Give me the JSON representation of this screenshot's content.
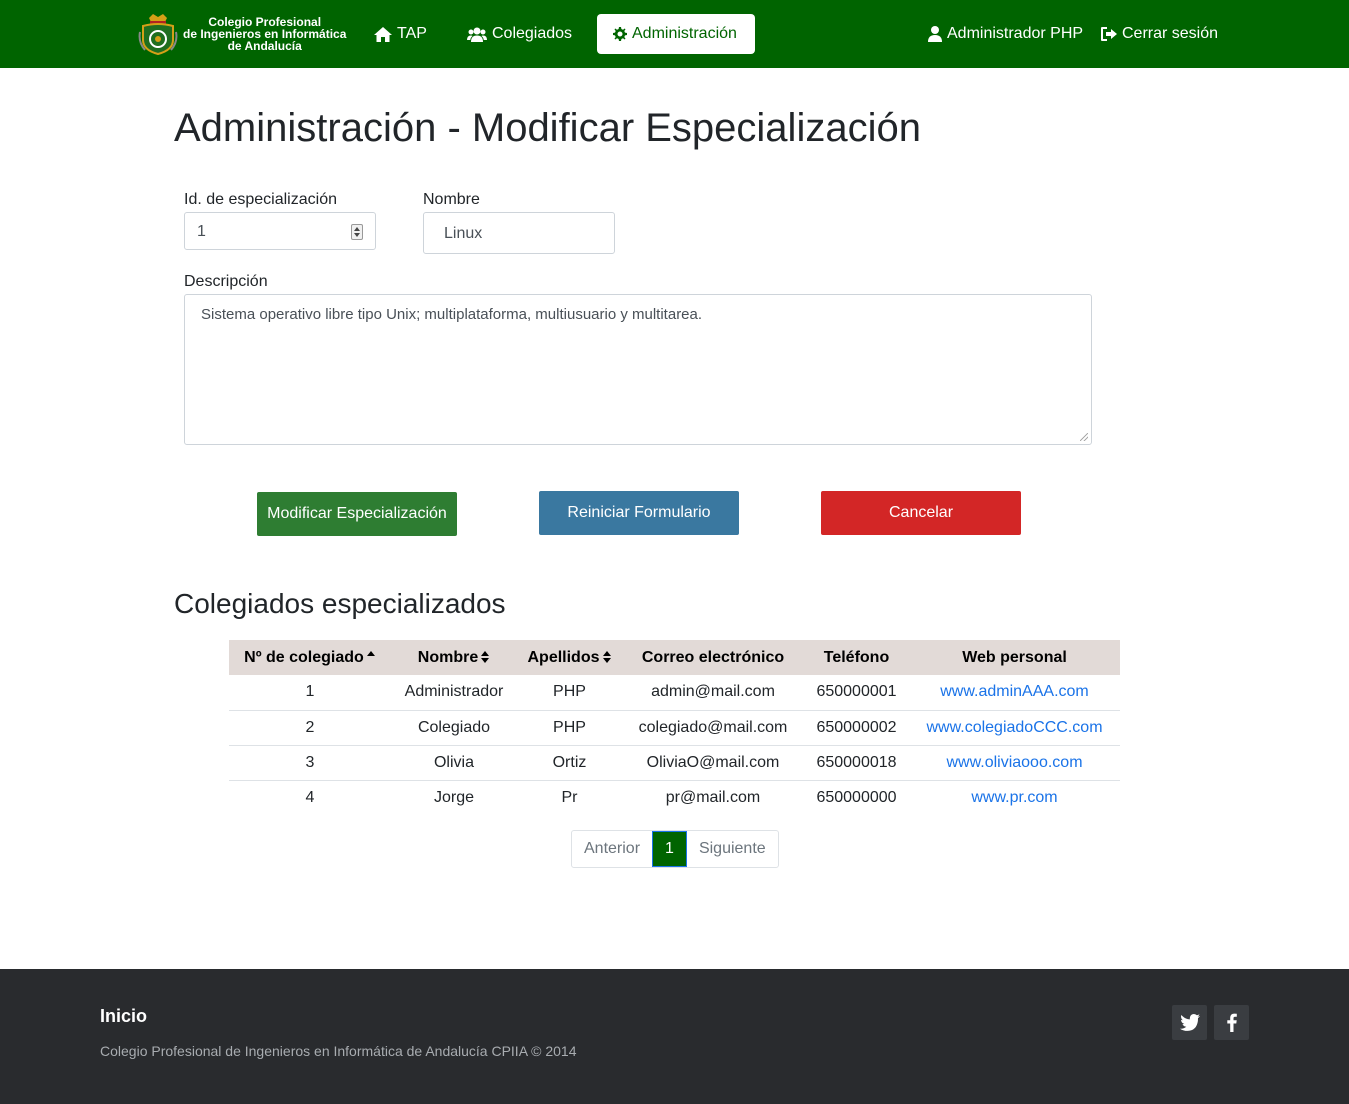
{
  "nav": {
    "brand_line1": "Colegio Profesional",
    "brand_line2": "de Ingenieros en Informática",
    "brand_line3": "de Andalucía",
    "items": [
      {
        "label": "TAP",
        "icon": "home-icon"
      },
      {
        "label": "Colegiados",
        "icon": "users-icon"
      },
      {
        "label": "Administración",
        "icon": "gear-icon",
        "active": true
      }
    ],
    "user_label": "Administrador PHP",
    "logout_label": "Cerrar sesión",
    "color": "#006400"
  },
  "page": {
    "title": "Administración - Modificar Especialización"
  },
  "form": {
    "id_label": "Id. de especialización",
    "id_value": "1",
    "name_label": "Nombre",
    "name_value": "Linux",
    "desc_label": "Descripción",
    "desc_value": "Sistema operativo libre tipo Unix; multiplataforma, multiusuario y multitarea.",
    "submit_label": "Modificar Especialización",
    "reset_label": "Reiniciar Formulario",
    "cancel_label": "Cancelar"
  },
  "table": {
    "title": "Colegiados especializados",
    "headers": [
      "Nº de colegiado",
      "Nombre",
      "Apellidos",
      "Correo electrónico",
      "Teléfono",
      "Web personal"
    ],
    "rows": [
      [
        "1",
        "Administrador",
        "PHP",
        "admin@mail.com",
        "650000001",
        "www.adminAAA.com"
      ],
      [
        "2",
        "Colegiado",
        "PHP",
        "colegiado@mail.com",
        "650000002",
        "www.colegiadoCCC.com"
      ],
      [
        "3",
        "Olivia",
        "Ortiz",
        "OliviaO@mail.com",
        "650000018",
        "www.oliviaooo.com"
      ],
      [
        "4",
        "Jorge",
        "Pr",
        "pr@mail.com",
        "650000000",
        "www.pr.com"
      ]
    ]
  },
  "pagination": {
    "prev_label": "Anterior",
    "current": "1",
    "next_label": "Siguiente"
  },
  "footer": {
    "title": "Inicio",
    "copyright": "Colegio Profesional de Ingenieros en Informática de Andalucía CPIIA © 2014",
    "social": [
      "twitter-icon",
      "facebook-icon"
    ]
  }
}
